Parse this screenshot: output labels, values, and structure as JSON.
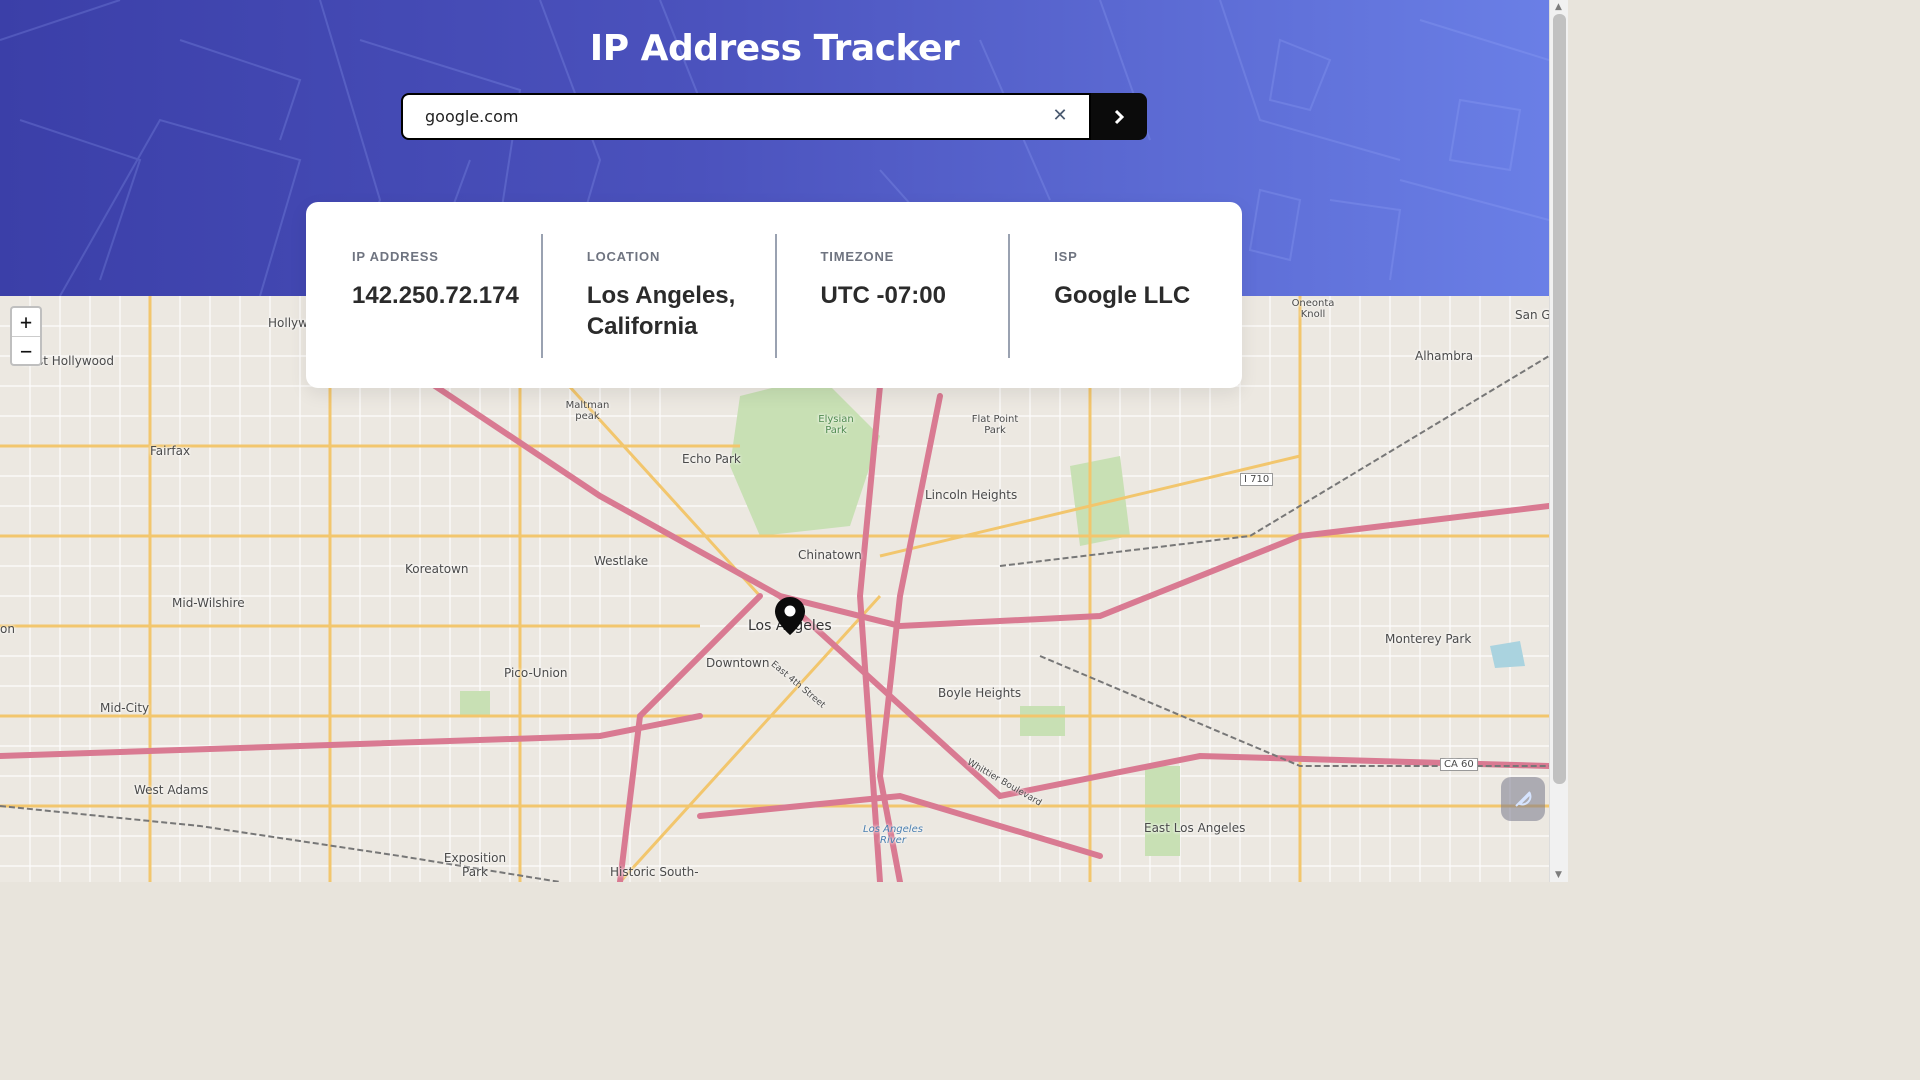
{
  "header": {
    "title": "IP Address Tracker"
  },
  "search": {
    "value": "google.com",
    "clear_icon": "close-icon",
    "submit_icon": "chevron-right-icon"
  },
  "info": [
    {
      "label": "IP Address",
      "value": "142.250.72.174"
    },
    {
      "label": "Location",
      "value": "Los Angeles, California"
    },
    {
      "label": "Timezone",
      "value": "UTC -07:00"
    },
    {
      "label": "ISP",
      "value": "Google LLC"
    }
  ],
  "map": {
    "zoom_in": "+",
    "zoom_out": "−",
    "marker_icon": "location-pin-icon",
    "places": {
      "hollywood": "Hollyw",
      "east_hollywood": "East Hollywood",
      "fairfax": "Fairfax",
      "mid_wilshire": "Mid-Wilshire",
      "koreatown": "Koreatown",
      "westlake": "Westlake",
      "echo_park": "Echo Park",
      "chinatown": "Chinatown",
      "los_angeles": "Los Angeles",
      "downtown": "Downtown",
      "pico_union": "Pico-Union",
      "mid_city": "Mid-City",
      "west_adams": "West Adams",
      "exposition_park": "Exposition Park",
      "historic_south": "Historic South-",
      "lincoln_heights": "Lincoln Heights",
      "boyle_heights": "Boyle Heights",
      "east_los_angeles": "East Los Angeles",
      "monterey_park": "Monterey Park",
      "alhambra": "Alhambra",
      "oneonta_knoll": "Oneonta Knoll",
      "san_g": "San G",
      "maltman_peak": "Maltman peak",
      "flat_point_park": "Flat Point Park",
      "elysian_park": "Elysian Park",
      "i710": "I 710",
      "ca60": "CA 60",
      "east_4th_street": "East 4th Street",
      "whittier_boulevard": "Whittier Boulevard",
      "los_angeles_river": "Los Angeles River",
      "lon": "on"
    }
  },
  "colors": {
    "header_start": "#3b3fa8",
    "header_end": "#6a7fe6",
    "freeway": "#d97a92",
    "arterial": "#f2c66d",
    "park": "#c8e0b4"
  }
}
